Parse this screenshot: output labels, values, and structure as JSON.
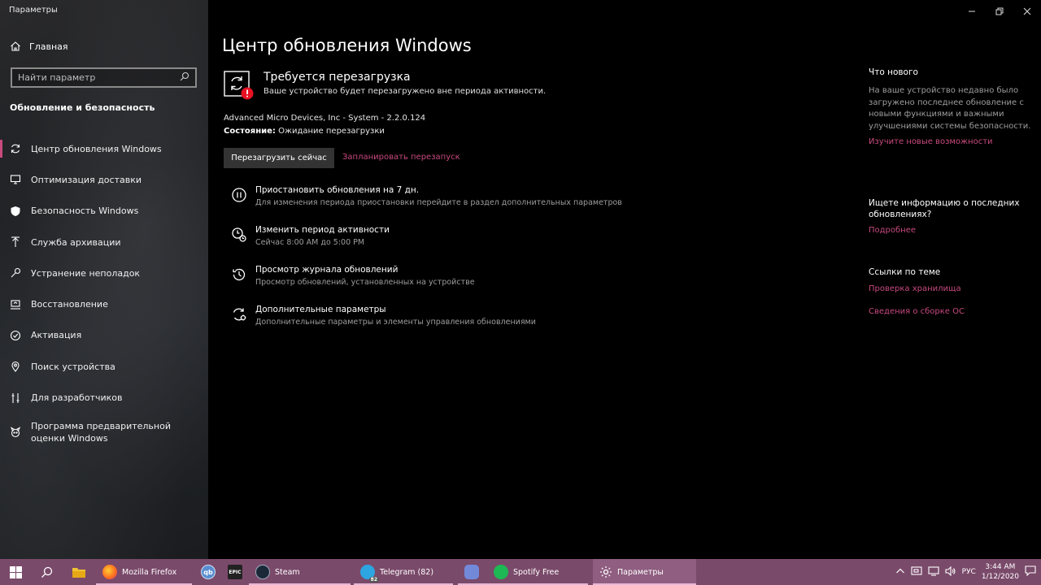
{
  "window": {
    "title": "Параметры"
  },
  "sidebar": {
    "home_label": "Главная",
    "search_placeholder": "Найти параметр",
    "section_title": "Обновление и безопасность",
    "items": [
      {
        "label": "Центр обновления Windows",
        "icon": "refresh-icon",
        "active": true
      },
      {
        "label": "Оптимизация доставки",
        "icon": "delivery-icon"
      },
      {
        "label": "Безопасность Windows",
        "icon": "shield-icon"
      },
      {
        "label": "Служба архивации",
        "icon": "backup-icon"
      },
      {
        "label": "Устранение неполадок",
        "icon": "wrench-icon"
      },
      {
        "label": "Восстановление",
        "icon": "recovery-icon"
      },
      {
        "label": "Активация",
        "icon": "check-circle-icon"
      },
      {
        "label": "Поиск устройства",
        "icon": "find-device-icon"
      },
      {
        "label": "Для разработчиков",
        "icon": "developer-icon"
      },
      {
        "label": "Программа предварительной оценки Windows",
        "icon": "insider-icon"
      }
    ]
  },
  "main": {
    "title": "Центр обновления Windows",
    "status": {
      "heading": "Требуется перезагрузка",
      "subtext": "Ваше устройство будет перезагружено вне периода активности."
    },
    "update_name": "Advanced Micro Devices, Inc - System - 2.2.0.124",
    "state_label": "Состояние:",
    "state_value": " Ожидание перезагрузки",
    "restart_button": "Перезагрузить сейчас",
    "schedule_link": "Запланировать перезапуск",
    "options": [
      {
        "title": "Приостановить обновления на 7 дн.",
        "desc": "Для изменения периода приостановки перейдите в раздел дополнительных параметров",
        "icon": "pause-icon"
      },
      {
        "title": "Изменить период активности",
        "desc": "Сейчас 8:00 AM до 5:00 PM",
        "icon": "active-hours-icon"
      },
      {
        "title": "Просмотр журнала обновлений",
        "desc": "Просмотр обновлений, установленных на устройстве",
        "icon": "history-icon"
      },
      {
        "title": "Дополнительные параметры",
        "desc": "Дополнительные параметры и элементы управления обновлениями",
        "icon": "advanced-settings-icon"
      }
    ]
  },
  "right": {
    "whats_new_title": "Что нового",
    "whats_new_text": "На ваше устройство недавно было загружено последнее обновление с новыми функциями и важными улучшениями системы безопасности.",
    "whats_new_link": "Изучите новые возможности",
    "info_title": "Ищете информацию о последних обновлениях?",
    "info_link": "Подробнее",
    "related_title": "Ссылки по теме",
    "related_links": [
      "Проверка хранилища",
      "Сведения о сборке ОС"
    ]
  },
  "taskbar": {
    "apps": [
      {
        "label": "Mozilla Firefox",
        "icon": "firefox-icon"
      },
      {
        "label": "",
        "icon": "qbittorrent-icon"
      },
      {
        "label": "",
        "icon": "epic-games-icon",
        "text": "EPIC"
      },
      {
        "label": "Steam",
        "icon": "steam-icon"
      },
      {
        "label": "Telegram (82)",
        "icon": "telegram-icon",
        "badge": "82"
      },
      {
        "label": "",
        "icon": "discord-icon"
      },
      {
        "label": "Spotify Free",
        "icon": "spotify-icon"
      },
      {
        "label": "Параметры",
        "icon": "settings-gear-icon"
      }
    ],
    "language": "РУС",
    "time": "3:44 AM",
    "date": "1/12/2020"
  },
  "colors": {
    "accent": "#c74a7d",
    "taskbar": "#7a4a6a"
  }
}
